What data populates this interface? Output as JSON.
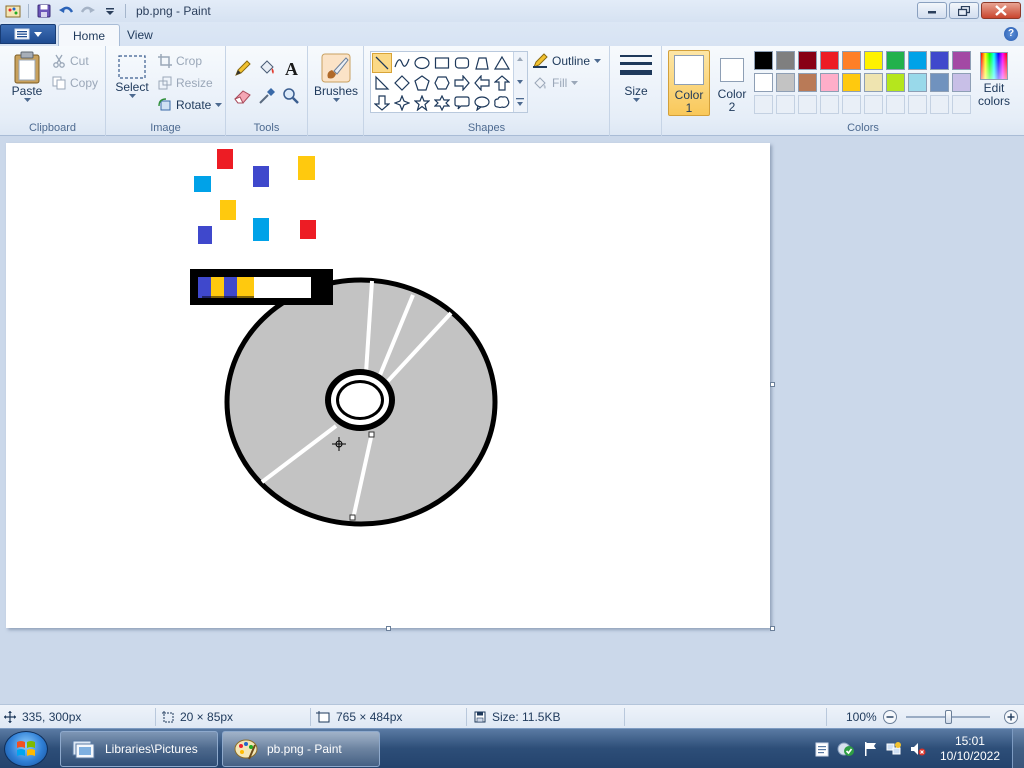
{
  "window": {
    "title": "pb.png - Paint",
    "controls": {
      "minimize": "minimize",
      "maximize": "restore",
      "close": "close"
    }
  },
  "tabs": [
    {
      "label": "Home",
      "active": true
    },
    {
      "label": "View",
      "active": false
    }
  ],
  "ribbon": {
    "clipboard": {
      "label": "Clipboard",
      "paste": "Paste",
      "cut": "Cut",
      "copy": "Copy"
    },
    "image": {
      "label": "Image",
      "select": "Select",
      "crop": "Crop",
      "resize": "Resize",
      "rotate": "Rotate"
    },
    "tools": {
      "label": "Tools",
      "icons": [
        "pencil-icon",
        "fill-icon",
        "text-icon",
        "eraser-icon",
        "color-picker-icon",
        "magnifier-icon"
      ]
    },
    "brushes": {
      "label": "Brushes"
    },
    "shapes": {
      "label": "Shapes",
      "outline": "Outline",
      "fill": "Fill",
      "items": [
        "line",
        "curve",
        "oval",
        "rectangle",
        "rounded-rectangle",
        "polygon",
        "triangle",
        "right-triangle",
        "diamond",
        "pentagon",
        "hexagon",
        "right-arrow",
        "left-arrow",
        "up-arrow",
        "down-arrow",
        "four-point-star",
        "five-point-star",
        "six-point-star",
        "rounded-callout",
        "oval-callout",
        "cloud-callout"
      ],
      "selected": "line"
    },
    "size": {
      "label": "Size"
    },
    "color1": {
      "label": "Color",
      "number": "1",
      "value": "#ffffff"
    },
    "color2": {
      "label": "Color",
      "number": "2",
      "value": "#ffffff"
    },
    "colors": {
      "label": "Colors",
      "row1": [
        "#000000",
        "#7f7f7f",
        "#880015",
        "#ed1c24",
        "#ff7f27",
        "#fff200",
        "#22b14c",
        "#00a2e8",
        "#3f48cc",
        "#a349a4"
      ],
      "row2": [
        "#ffffff",
        "#c3c3c3",
        "#b97a57",
        "#ffaec9",
        "#ffc90e",
        "#efe4b0",
        "#b5e61d",
        "#99d9ea",
        "#7092be",
        "#c8bfe7"
      ],
      "row3_empty_count": 10
    },
    "edit_colors": {
      "line1": "Edit",
      "line2": "colors"
    }
  },
  "statusbar": {
    "cursor_pos": "335, 300px",
    "selection_size": "20 × 85px",
    "image_size": "765 × 484px",
    "file_size": "Size: 11.5KB",
    "zoom": "100%",
    "zoom_level": 100
  },
  "taskbar": {
    "items": [
      {
        "label": "Libraries\\Pictures",
        "active": false
      },
      {
        "label": "pb.png - Paint",
        "active": true
      }
    ],
    "time": "15:01",
    "date": "10/10/2022"
  },
  "drawing": {
    "squares": [
      {
        "color": "#ed1c24"
      },
      {
        "color": "#3f48cc"
      },
      {
        "color": "#ffc90e"
      },
      {
        "color": "#00a2e8"
      },
      {
        "color": "#ffc90e"
      },
      {
        "color": "#3f48cc"
      },
      {
        "color": "#00a2e8"
      },
      {
        "color": "#ed1c24"
      }
    ],
    "disc_color": "#c3c3c3",
    "label_stripes": [
      "#3f48cc",
      "#ffc90e",
      "#3f48cc",
      "#ffc90e"
    ]
  }
}
